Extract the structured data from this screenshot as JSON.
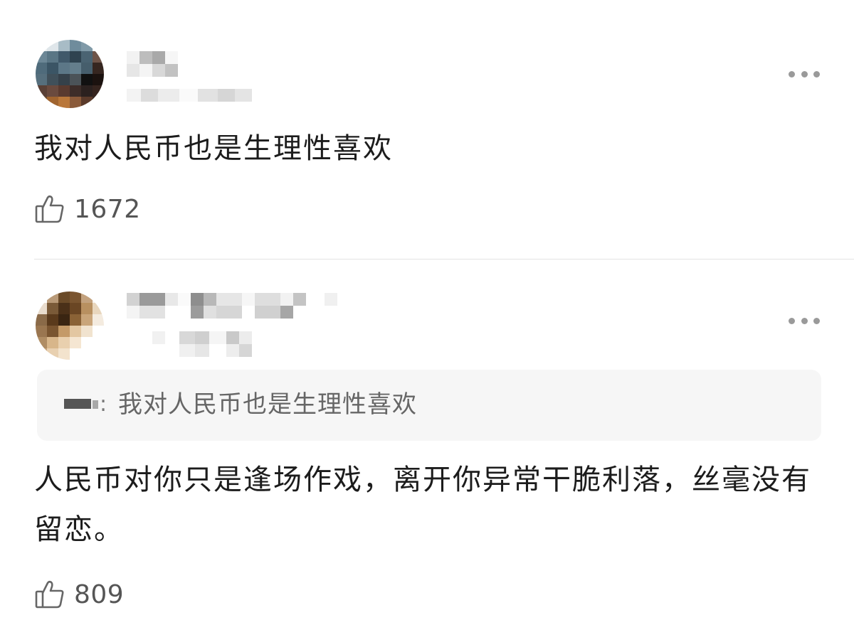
{
  "comments": [
    {
      "text": "我对人民币也是生理性喜欢",
      "likes": "1672"
    },
    {
      "quote": {
        "separator": ":",
        "text": "我对人民币也是生理性喜欢"
      },
      "text": "人民币对你只是逢场作戏，离开你异常干脆利落，丝毫没有留恋。",
      "likes": "809"
    }
  ],
  "icons": {
    "like": "thumbs-up-icon",
    "more": "more-icon"
  },
  "colors": {
    "text": "#1c1c1c",
    "secondary_text": "#666666",
    "quote_background": "#f6f6f6",
    "divider": "#e3e3e3"
  }
}
